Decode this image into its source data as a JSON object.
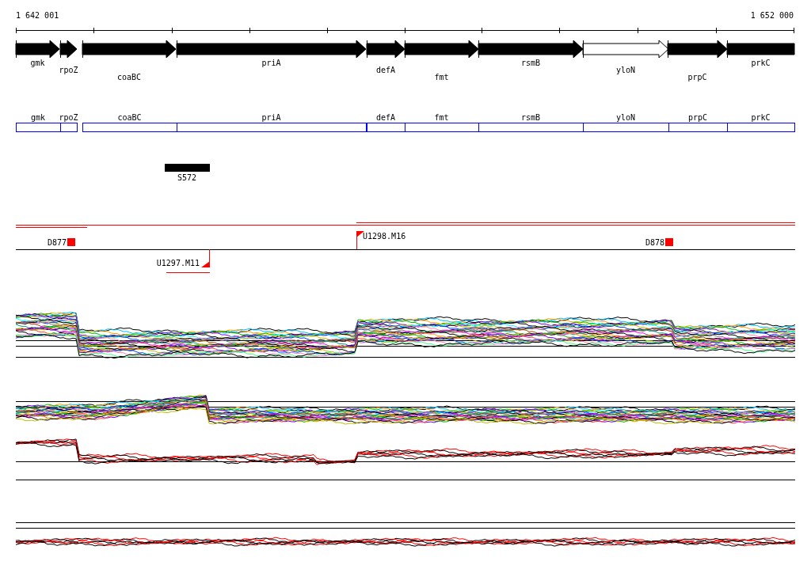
{
  "ruler": {
    "start_label": "1 642 001",
    "end_label": "1 652 000"
  },
  "genes": [
    {
      "name": "gmk",
      "kind": "filled"
    },
    {
      "name": "rpoZ",
      "kind": "filled"
    },
    {
      "name": "coaBC",
      "kind": "filled"
    },
    {
      "name": "priA",
      "kind": "filled"
    },
    {
      "name": "defA",
      "kind": "filled"
    },
    {
      "name": "fmt",
      "kind": "filled"
    },
    {
      "name": "rsmB",
      "kind": "filled"
    },
    {
      "name": "yloN",
      "kind": "hollow"
    },
    {
      "name": "prpC",
      "kind": "filled"
    },
    {
      "name": "prkC",
      "kind": "cut"
    }
  ],
  "gene_boxes": [
    "gmk",
    "rpoZ",
    "coaBC",
    "priA",
    "defA",
    "fmt",
    "rsmB",
    "yloN",
    "prpC",
    "prkC"
  ],
  "regions": [
    {
      "label": "S572"
    }
  ],
  "markers": [
    {
      "label": "D877",
      "kind": "square"
    },
    {
      "label": "U1298.M16",
      "kind": "flag-up"
    },
    {
      "label": "D878",
      "kind": "square"
    },
    {
      "label": "U1297.M11",
      "kind": "flag-down"
    }
  ]
}
